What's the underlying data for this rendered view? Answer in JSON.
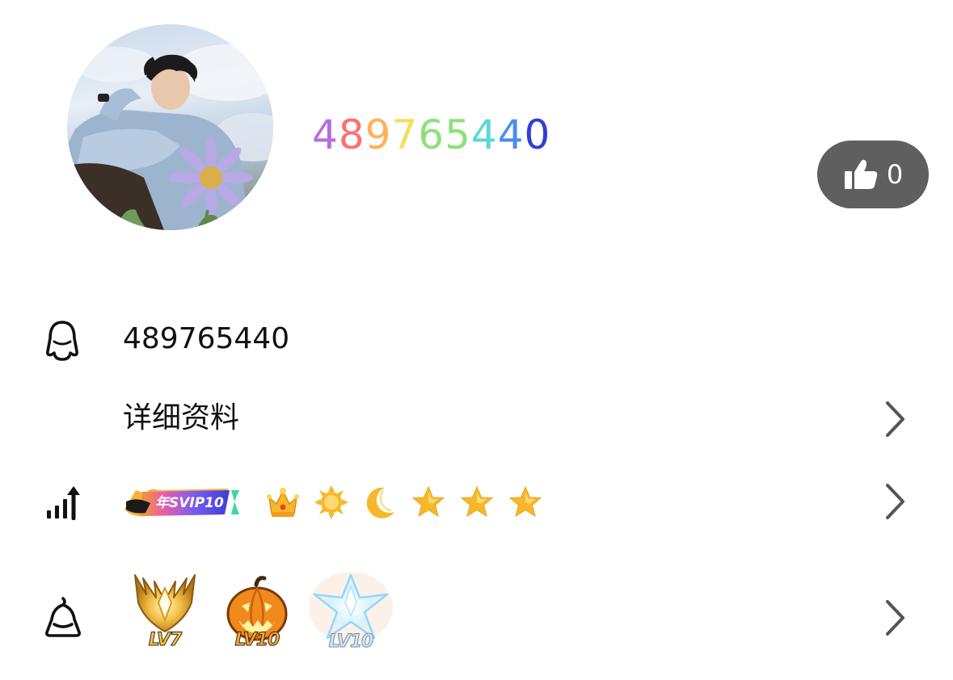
{
  "profile": {
    "display_name": "489765440",
    "name_gradient": [
      "#b66de0",
      "#ff6f6f",
      "#ffb15a",
      "#f3e05a",
      "#8ee07a",
      "#5ad8d8",
      "#4a8cf0",
      "#2f3fd8"
    ],
    "like_count": "0"
  },
  "rows": {
    "qq": {
      "icon": "penguin-icon",
      "value": "489765440"
    },
    "details": {
      "label": "详细资料"
    },
    "level": {
      "icon": "level-up-icon",
      "svip_badge_text": "年SVIP10",
      "level_icons": [
        "crown-icon",
        "sun-icon",
        "moon-icon",
        "star-icon",
        "star-icon",
        "star-icon"
      ]
    },
    "medals": {
      "icon": "qq-show-icon",
      "items": [
        {
          "icon": "gold-wing-medal-icon",
          "label": "LV7"
        },
        {
          "icon": "pumpkin-medal-icon",
          "label": "LV10"
        },
        {
          "icon": "crystal-star-medal-icon",
          "label": "LV10"
        }
      ]
    }
  },
  "colors": {
    "like_button_bg": "#5f5f5f",
    "text": "#111111",
    "chevron": "#555555",
    "level_gold": "#f6b82a"
  }
}
